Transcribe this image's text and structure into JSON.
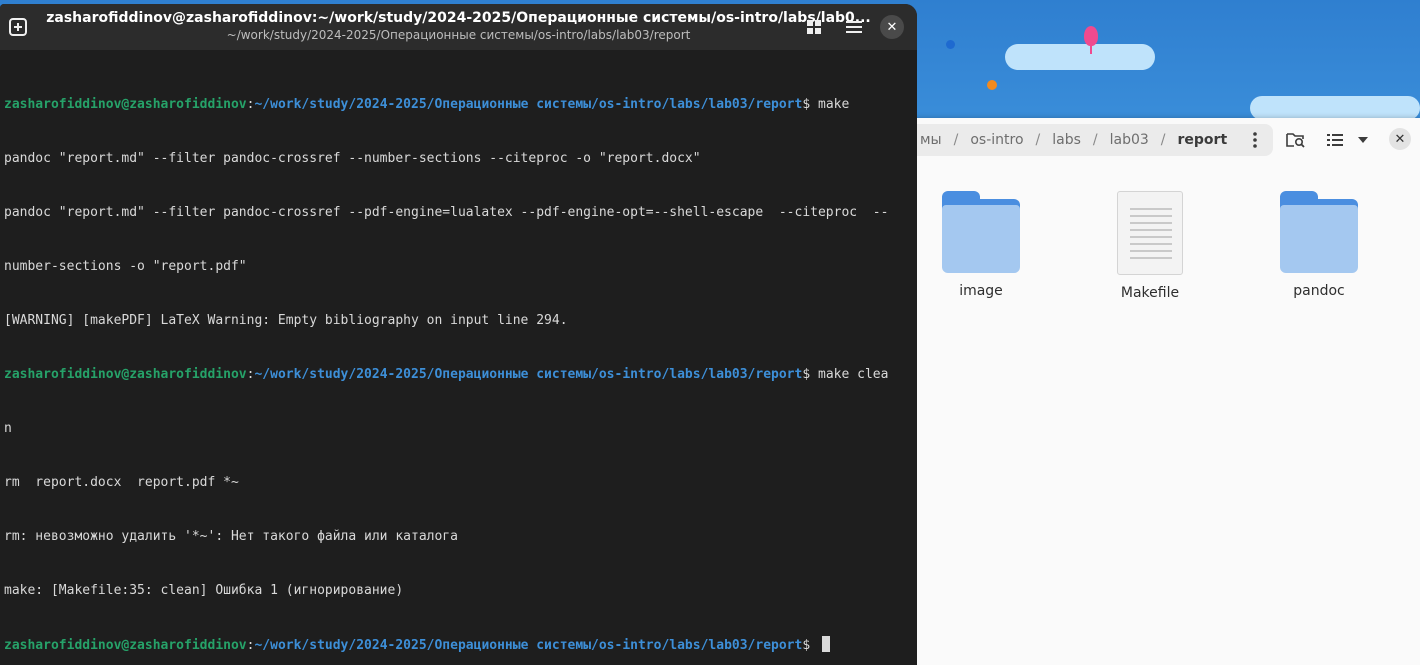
{
  "terminal": {
    "title": "zasharofiddinov@zasharofiddinov:~/work/study/2024-2025/Операционные системы/os-intro/labs/lab0...",
    "subtitle": "~/work/study/2024-2025/Операционные системы/os-intro/labs/lab03/report",
    "icons": {
      "new_tab": "new-tab-icon",
      "view": "grid-icon",
      "menu": "hamburger-menu-icon",
      "close": "close-icon"
    },
    "prompt_user": "zasharofiddinov@zasharofiddinov",
    "prompt_colon": ":",
    "prompt_path": "~/work/study/2024-2025/Операционные системы/os-intro/labs/lab03/report",
    "prompt_symbol": "$ ",
    "cmd1": "make",
    "out1": "pandoc \"report.md\" --filter pandoc-crossref --number-sections --citeproc -o \"report.docx\"",
    "out2": "pandoc \"report.md\" --filter pandoc-crossref --pdf-engine=lualatex --pdf-engine-opt=--shell-escape  --citeproc  --",
    "out3": "number-sections -o \"report.pdf\"",
    "out4": "[WARNING] [makePDF] LaTeX Warning: Empty bibliography on input line 294.",
    "cmd2": "make clea",
    "cmd2_wrap": "n",
    "out5": "rm  report.docx  report.pdf *~",
    "out6": "rm: невозможно удалить '*~': Нет такого файла или каталога",
    "out7": "make: [Makefile:35: clean] Ошибка 1 (игнорирование)"
  },
  "files": {
    "breadcrumbs": [
      "мы",
      "os-intro",
      "labs",
      "lab03",
      "report"
    ],
    "separator": "/",
    "items": [
      {
        "label": "image",
        "icon": "folder-icon"
      },
      {
        "label": "Makefile",
        "icon": "text-file-icon"
      },
      {
        "label": "pandoc",
        "icon": "folder-icon"
      }
    ],
    "icons": {
      "more": "kebab-menu-icon",
      "search": "search-folder-icon",
      "view": "list-view-icon",
      "dropdown": "chevron-down-icon",
      "close": "close-icon"
    }
  }
}
